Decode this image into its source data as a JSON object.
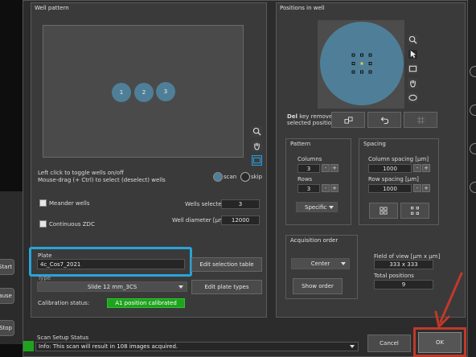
{
  "well_pattern": {
    "title": "Well pattern",
    "wells": [
      "1",
      "2",
      "3"
    ],
    "hint_line1": "Left click to toggle wells on/off",
    "hint_line2": "Mouse-drag (+ Ctrl) to select (deselect) wells",
    "mode_scan": "scan",
    "mode_skip": "skip",
    "meander_label": "Meander wells",
    "continuous_zdc_label": "Continuous ZDC",
    "wells_selected_label": "Wells selected",
    "wells_selected_value": "3",
    "well_diameter_label": "Well diameter [µm]",
    "well_diameter_value": "12000",
    "plate_label": "Plate",
    "plate_value": "4c_Cos7_2021",
    "type_label": "Type",
    "type_value": "Slide 12 mm_3CS",
    "edit_selection_table": "Edit selection table",
    "edit_plate_types": "Edit plate types",
    "calibration_label": "Calibration status:",
    "calibration_value": "A1 position calibrated"
  },
  "positions": {
    "title": "Positions in well",
    "del_hint_bold": "Del",
    "del_hint_rest": " key removes",
    "del_hint_line2": "selected positions",
    "pattern_title": "Pattern",
    "columns_label": "Columns",
    "columns_value": "3",
    "rows_label": "Rows",
    "rows_value": "3",
    "pattern_type": "Specific",
    "spacing_title": "Spacing",
    "col_spacing_label": "Column spacing [µm]",
    "col_spacing_value": "1000",
    "row_spacing_label": "Row spacing [µm]",
    "row_spacing_value": "1000",
    "acq_title": "Acquisition order",
    "acq_value": "Center",
    "show_order": "Show order",
    "fov_label": "Field of view [µm x µm]",
    "fov_value": "333 x 333",
    "total_label": "Total positions",
    "total_value": "9"
  },
  "status": {
    "title": "Scan Setup Status",
    "info": "Info: This scan will result in 108 images acquired."
  },
  "buttons": {
    "cancel": "Cancel",
    "ok": "OK"
  },
  "left_edge": [
    "Start",
    "Pause",
    "Stop"
  ],
  "colors": {
    "well": "#4f7f98",
    "highlight_blue": "#29a3d9",
    "highlight_red": "#c0392b",
    "ok_green": "#1fa31f"
  }
}
